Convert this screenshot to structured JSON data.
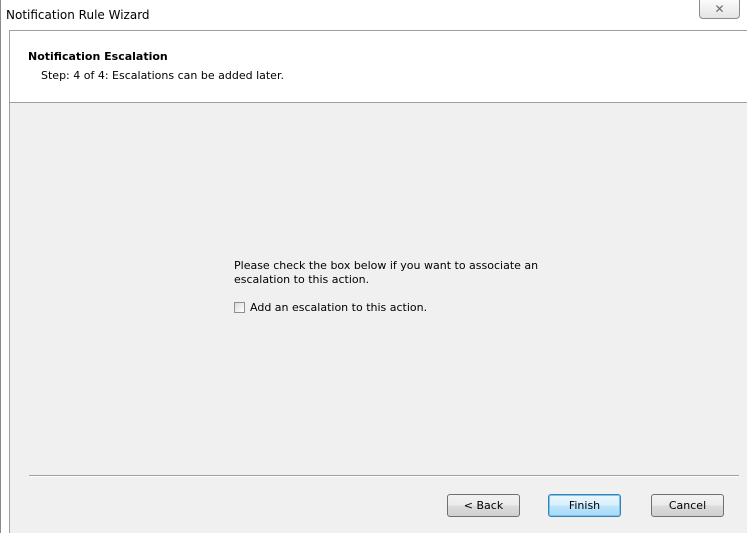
{
  "window": {
    "title": "Notification Rule Wizard",
    "close_glyph": "✕"
  },
  "header": {
    "title": "Notification Escalation",
    "step": "Step: 4 of 4: Escalations can be added later."
  },
  "content": {
    "message": "Please check the box below if you want to associate an escalation to this action.",
    "checkbox": {
      "label": "Add an escalation to this action.",
      "checked": false
    }
  },
  "buttons": {
    "back": "< Back",
    "finish": "Finish",
    "cancel": "Cancel"
  }
}
